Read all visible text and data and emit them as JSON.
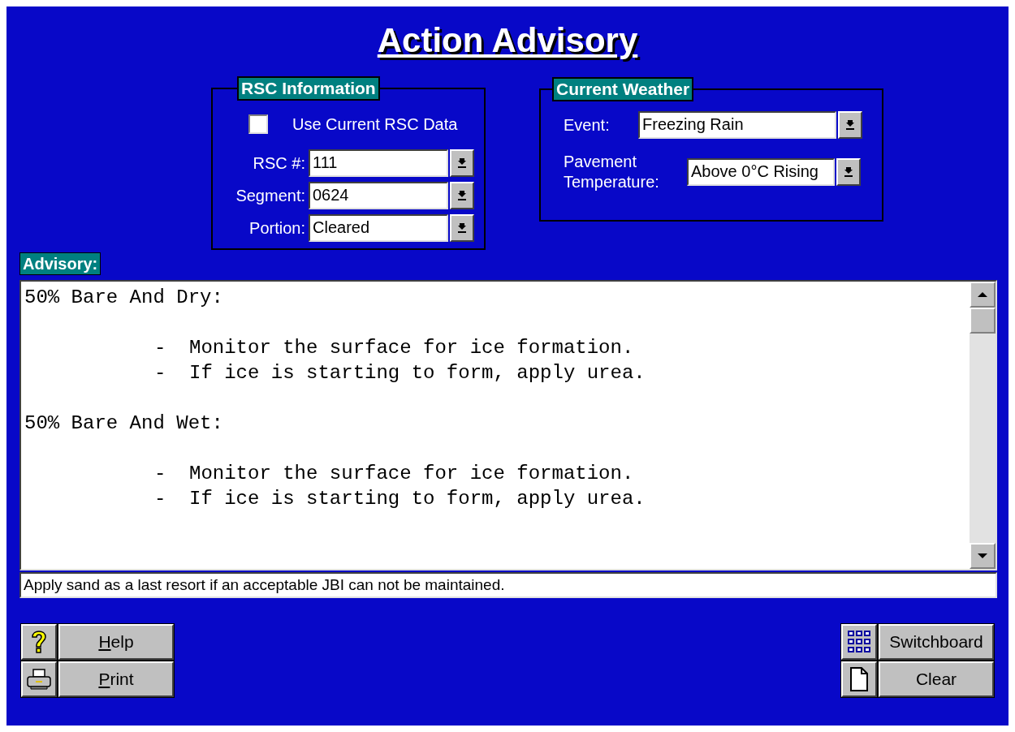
{
  "title": "Action Advisory",
  "rsc_information": {
    "legend": "RSC Information",
    "use_current": {
      "label": "Use Current RSC Data",
      "checked": false
    },
    "fields": [
      {
        "label": "RSC #:",
        "value": "111"
      },
      {
        "label": "Segment:",
        "value": "0624"
      },
      {
        "label": "Portion:",
        "value": "Cleared"
      }
    ]
  },
  "current_weather": {
    "legend": "Current Weather",
    "fields": [
      {
        "label": "Event:",
        "value": "Freezing Rain"
      },
      {
        "label": "Pavement Temperature:",
        "value": "Above 0°C Rising"
      }
    ]
  },
  "advisory": {
    "label": "Advisory:",
    "sections": [
      {
        "heading": "50% Bare And Dry:",
        "items": [
          {
            "marker": "-",
            "text": "Monitor the surface for ice formation."
          },
          {
            "marker": "-",
            "text": "If ice is starting to form, apply urea."
          }
        ]
      },
      {
        "heading": "50% Bare And Wet:",
        "items": [
          {
            "marker": "-",
            "text": "Monitor the surface for ice formation."
          },
          {
            "marker": "-",
            "text": "If ice is starting to form, apply urea."
          }
        ]
      }
    ],
    "note": "Apply sand as a last resort if an acceptable JBI can not be maintained."
  },
  "buttons_left": [
    {
      "kind": "help",
      "label": "Help",
      "mnemonic": true
    },
    {
      "kind": "print",
      "label": "Print",
      "mnemonic": true
    }
  ],
  "buttons_right": [
    {
      "kind": "switchboard",
      "label": "Switchboard",
      "mnemonic": false
    },
    {
      "kind": "clear",
      "label": "Clear",
      "mnemonic": false
    }
  ]
}
